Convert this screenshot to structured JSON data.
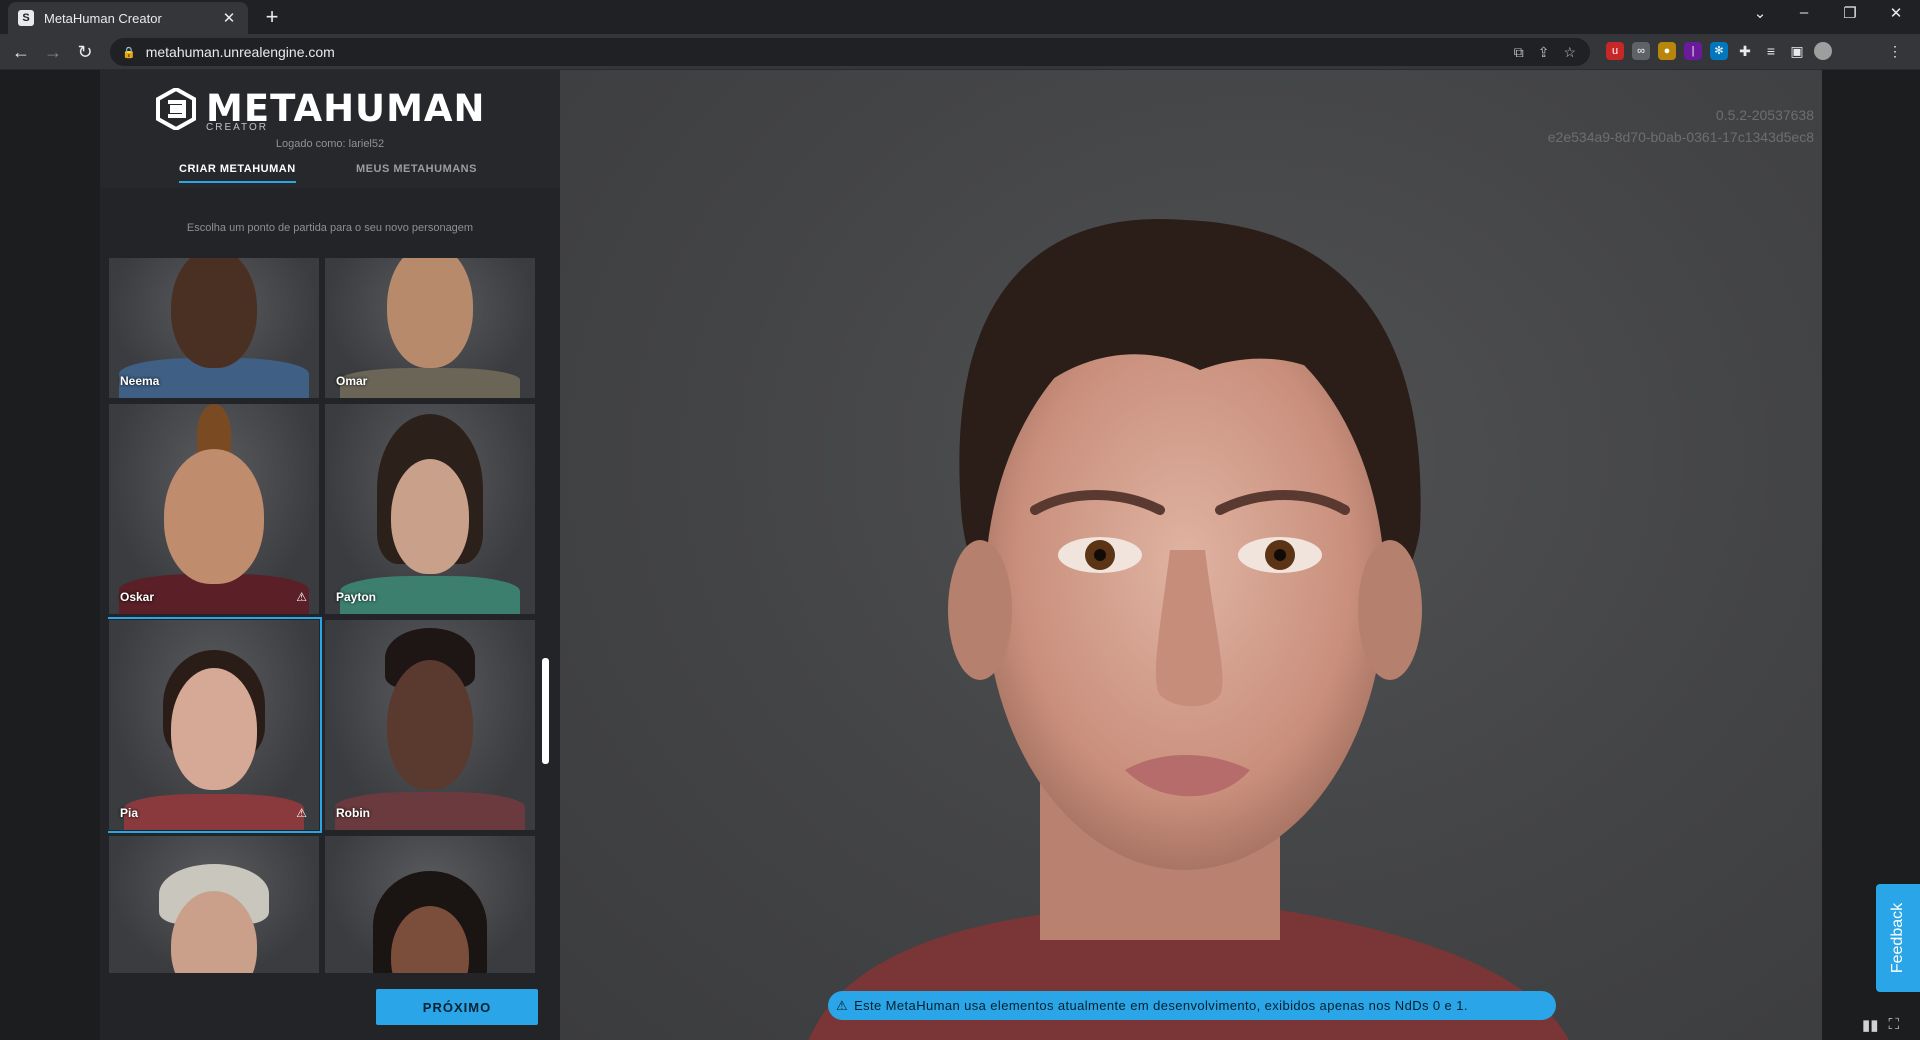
{
  "browser": {
    "tab_title": "MetaHuman Creator",
    "tab_favicon": "metahuman-logo-icon",
    "url": "metahuman.unrealengine.com",
    "window_controls": [
      "minimize",
      "restore",
      "close"
    ]
  },
  "app": {
    "logo_text": "METAHUMAN",
    "logo_subtext": "CREATOR",
    "logged_in": "Logado como: lariel52",
    "tabs": [
      {
        "label": "CRIAR METAHUMAN",
        "active": true
      },
      {
        "label": "MEUS METAHUMANS",
        "active": false
      }
    ],
    "hint": "Escolha um ponto de partida para o seu novo personagem",
    "presets": [
      {
        "name": "Neema",
        "warning": false,
        "selected": false
      },
      {
        "name": "Omar",
        "warning": false,
        "selected": false
      },
      {
        "name": "Oskar",
        "warning": true,
        "selected": false
      },
      {
        "name": "Payton",
        "warning": false,
        "selected": false
      },
      {
        "name": "Pia",
        "warning": true,
        "selected": true
      },
      {
        "name": "Robin",
        "warning": false,
        "selected": false
      },
      {
        "name": "",
        "warning": false,
        "selected": false
      },
      {
        "name": "",
        "warning": false,
        "selected": false
      }
    ],
    "next_label": "PRÓXIMO"
  },
  "viewport": {
    "version": "0.5.2-20537638",
    "session_id": "e2e534a9-8d70-b0ab-0361-17c1343d5ec8",
    "banner_text": "Este MetaHuman usa elementos atualmente em desenvolvimento, exibidos apenas nos NdDs 0 e 1.",
    "feedback_label": "Feedback"
  },
  "colors": {
    "accent": "#2aa6e8",
    "panel": "#232427",
    "viewport": "#434446"
  }
}
